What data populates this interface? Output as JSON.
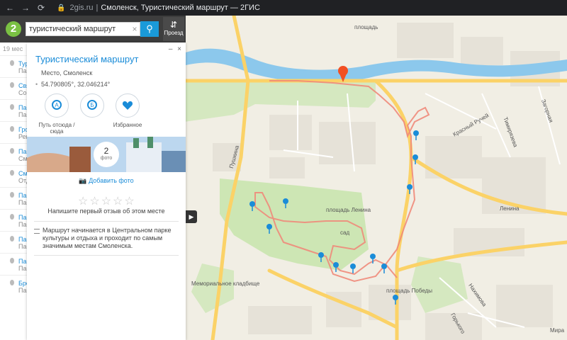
{
  "browser": {
    "host": "2gis.ru",
    "title": "Смоленск, Туристический маршрут — 2ГИС"
  },
  "search": {
    "value": "туристический маршрут",
    "route_label": "Проезд"
  },
  "results": {
    "count_label": "19 мес",
    "items": [
      {
        "title": "Тур",
        "sub": "Пар"
      },
      {
        "title": "Свя",
        "sub": "Соп"
      },
      {
        "title": "Пам",
        "sub": "Пам"
      },
      {
        "title": "Гро",
        "sub": "Рем"
      },
      {
        "title": "Пам",
        "sub": "Смо"
      },
      {
        "title": "Смо",
        "sub": "Отд"
      },
      {
        "title": "Пам",
        "sub": "Пам"
      },
      {
        "title": "Пам",
        "sub": "Пам"
      },
      {
        "title": "Пам",
        "sub": "Пам"
      },
      {
        "title": "Пам",
        "sub": "Пам"
      },
      {
        "title": "Бро",
        "sub": "Пам"
      }
    ]
  },
  "card": {
    "title": "Туристический маршрут",
    "subtitle": "Место, Смоленск",
    "coords": "54.790805°, 32.046214°",
    "actions": [
      {
        "label": "Путь отсюда / сюда",
        "icon": "route-from-icon"
      },
      {
        "label": "",
        "icon": "route-to-icon"
      },
      {
        "label": "Избранное",
        "icon": "heart-icon"
      }
    ],
    "photo_count": "2",
    "photo_unit": "фото",
    "add_photo": "Добавить фото",
    "review_prompt": "Напишите первый отзыв об этом месте",
    "description": "Маршрут начинается в Центральном парке культуры и отдыха и проходит по самым значимым местам Смоленска.",
    "rating": 0,
    "max_rating": 5
  },
  "map_labels": {
    "ploshchad_top": "площадь",
    "krasny_ruchei": "Красный Ручей",
    "timiryazeva": "Тимирязева",
    "zaozernaya": "Загорная",
    "pushkina": "Пушкина",
    "lenina": "Ленина",
    "ploshchad": "площадь Ленина",
    "sad": "сад",
    "memorial": "Мемориальное кладбище",
    "pobedy": "площадь Победы",
    "nakhimova": "Нахимова",
    "gorkogo": "Горького",
    "mira": "Мира"
  },
  "colors": {
    "accent": "#1a9ad9",
    "route": "#f08a7a",
    "river": "#6fb7e8",
    "park": "#cde6b4",
    "road": "#fbd267",
    "pin": "#1a8cd8",
    "marker": "#f24f22"
  }
}
